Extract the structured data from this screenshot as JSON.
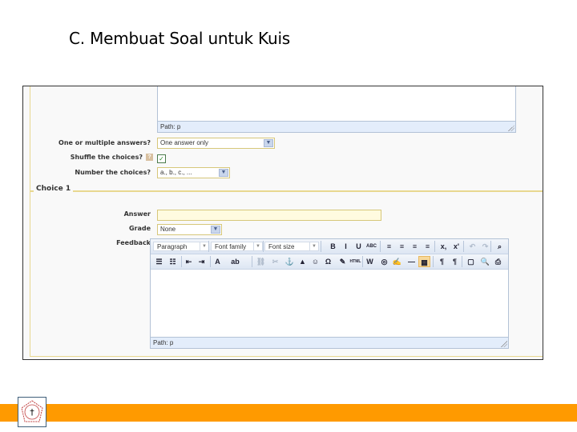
{
  "slide": {
    "title": "C. Membuat Soal untuk Kuis"
  },
  "form": {
    "top_editor": {
      "path_label": "Path: p"
    },
    "multiple_answers": {
      "label": "One or multiple answers?",
      "value": "One answer only"
    },
    "shuffle": {
      "label": "Shuffle the choices?",
      "help": "?",
      "checked": true,
      "check_glyph": "✓"
    },
    "numbering": {
      "label": "Number the choices?",
      "value": "a., b., c., ..."
    }
  },
  "choice": {
    "legend": "Choice 1",
    "answer": {
      "label": "Answer",
      "value": ""
    },
    "grade": {
      "label": "Grade",
      "value": "None"
    },
    "feedback": {
      "label": "Feedback",
      "toolbar": {
        "format": "Paragraph",
        "font_family": "Font family",
        "font_size": "Font size",
        "buttons_row1": [
          {
            "name": "bold-icon",
            "glyph": "B"
          },
          {
            "name": "italic-icon",
            "glyph": "I"
          },
          {
            "name": "underline-icon",
            "glyph": "U"
          },
          {
            "name": "strikethrough-icon",
            "glyph": "ABC"
          },
          {
            "name": "align-left-icon",
            "glyph": "≡"
          },
          {
            "name": "align-center-icon",
            "glyph": "≡"
          },
          {
            "name": "align-right-icon",
            "glyph": "≡"
          },
          {
            "name": "align-justify-icon",
            "glyph": "≡"
          },
          {
            "name": "subscript-icon",
            "glyph": "x,"
          },
          {
            "name": "superscript-icon",
            "glyph": "x'"
          },
          {
            "name": "undo-icon",
            "glyph": "↶"
          },
          {
            "name": "redo-icon",
            "glyph": "↷"
          },
          {
            "name": "find-icon",
            "glyph": "⌕"
          }
        ],
        "buttons_row2": [
          {
            "name": "bullet-list-icon",
            "glyph": "☰"
          },
          {
            "name": "numbered-list-icon",
            "glyph": "☷"
          },
          {
            "name": "outdent-icon",
            "glyph": "⇤"
          },
          {
            "name": "indent-icon",
            "glyph": "⇥"
          },
          {
            "name": "text-color-icon",
            "glyph": "A"
          },
          {
            "name": "highlight-color-icon",
            "glyph": "ab"
          },
          {
            "name": "link-icon",
            "glyph": "⛓"
          },
          {
            "name": "unlink-icon",
            "glyph": "✂"
          },
          {
            "name": "anchor-icon",
            "glyph": "⚓"
          },
          {
            "name": "image-icon",
            "glyph": "▲"
          },
          {
            "name": "emoticon-icon",
            "glyph": "☺"
          },
          {
            "name": "special-char-icon",
            "glyph": "Ω"
          },
          {
            "name": "clean-up-icon",
            "glyph": "✎"
          },
          {
            "name": "html-source-icon",
            "glyph": "HTML"
          },
          {
            "name": "paste-word-icon",
            "glyph": "W"
          },
          {
            "name": "moodle-media-icon",
            "glyph": "◎"
          },
          {
            "name": "edit-icon",
            "glyph": "✍"
          },
          {
            "name": "horizontal-rule-icon",
            "glyph": "—"
          },
          {
            "name": "table-icon",
            "glyph": "▦"
          },
          {
            "name": "ltr-icon",
            "glyph": "¶"
          },
          {
            "name": "rtl-icon",
            "glyph": "¶"
          },
          {
            "name": "fullscreen-icon",
            "glyph": "▢"
          },
          {
            "name": "preview-icon",
            "glyph": "🔍"
          },
          {
            "name": "print-icon",
            "glyph": "⎙"
          }
        ]
      },
      "path_label": "Path: p"
    }
  },
  "colors": {
    "accent_bar": "#ff9a00",
    "fieldset_border": "#e8d890"
  }
}
